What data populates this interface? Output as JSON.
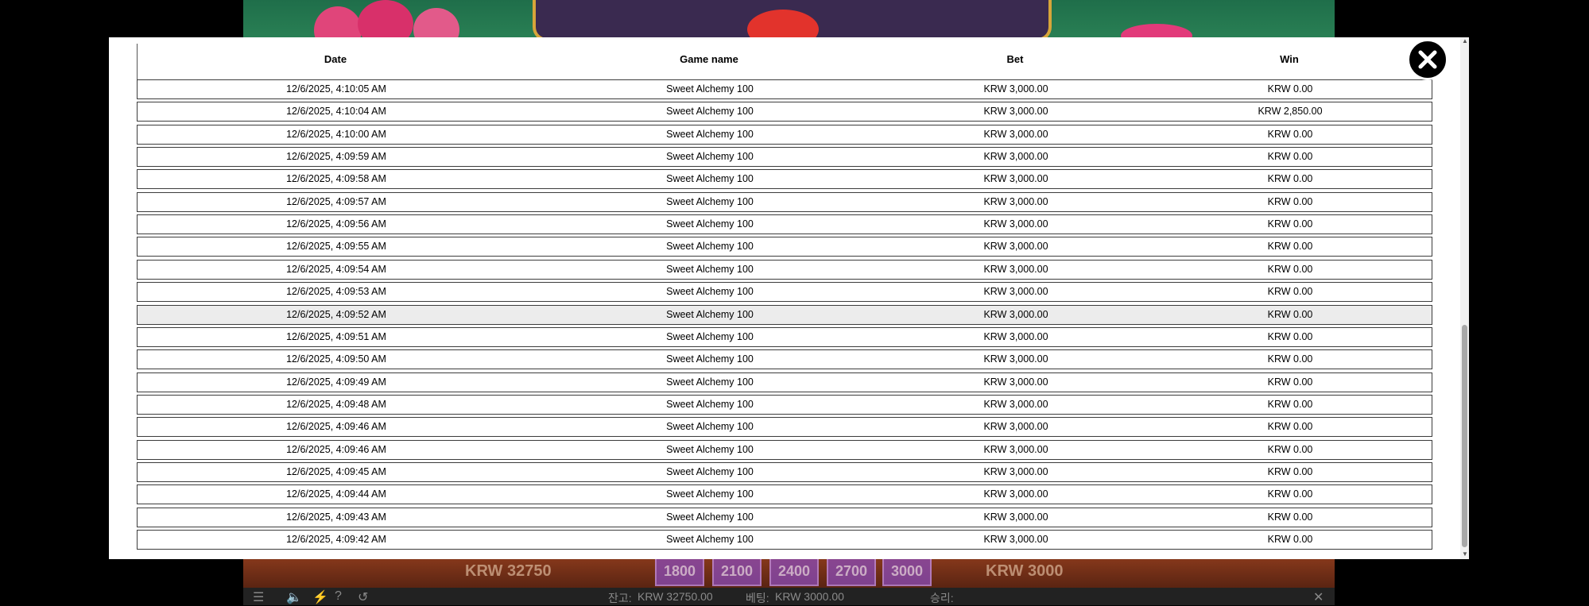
{
  "game_hud": {
    "balance_amount": "KRW 32750",
    "bet_amount": "KRW 3000",
    "bet_chips": [
      "1800",
      "2100",
      "2400",
      "2700",
      "3000"
    ],
    "balance_label": "잔고:",
    "balance_value": "KRW 32750.00",
    "bet_label": "베팅:",
    "bet_value": "KRW 3000.00",
    "win_label": "승리:"
  },
  "history": {
    "headers": {
      "date": "Date",
      "game_name": "Game name",
      "bet": "Bet",
      "win": "Win"
    },
    "rows": [
      {
        "date": "12/6/2025, 4:10:05 AM",
        "game": "Sweet Alchemy 100",
        "bet": "KRW 3,000.00",
        "win": "KRW 0.00"
      },
      {
        "date": "12/6/2025, 4:10:04 AM",
        "game": "Sweet Alchemy 100",
        "bet": "KRW 3,000.00",
        "win": "KRW 2,850.00"
      },
      {
        "date": "12/6/2025, 4:10:00 AM",
        "game": "Sweet Alchemy 100",
        "bet": "KRW 3,000.00",
        "win": "KRW 0.00"
      },
      {
        "date": "12/6/2025, 4:09:59 AM",
        "game": "Sweet Alchemy 100",
        "bet": "KRW 3,000.00",
        "win": "KRW 0.00"
      },
      {
        "date": "12/6/2025, 4:09:58 AM",
        "game": "Sweet Alchemy 100",
        "bet": "KRW 3,000.00",
        "win": "KRW 0.00"
      },
      {
        "date": "12/6/2025, 4:09:57 AM",
        "game": "Sweet Alchemy 100",
        "bet": "KRW 3,000.00",
        "win": "KRW 0.00"
      },
      {
        "date": "12/6/2025, 4:09:56 AM",
        "game": "Sweet Alchemy 100",
        "bet": "KRW 3,000.00",
        "win": "KRW 0.00"
      },
      {
        "date": "12/6/2025, 4:09:55 AM",
        "game": "Sweet Alchemy 100",
        "bet": "KRW 3,000.00",
        "win": "KRW 0.00"
      },
      {
        "date": "12/6/2025, 4:09:54 AM",
        "game": "Sweet Alchemy 100",
        "bet": "KRW 3,000.00",
        "win": "KRW 0.00"
      },
      {
        "date": "12/6/2025, 4:09:53 AM",
        "game": "Sweet Alchemy 100",
        "bet": "KRW 3,000.00",
        "win": "KRW 0.00"
      },
      {
        "date": "12/6/2025, 4:09:52 AM",
        "game": "Sweet Alchemy 100",
        "bet": "KRW 3,000.00",
        "win": "KRW 0.00",
        "highlighted": true
      },
      {
        "date": "12/6/2025, 4:09:51 AM",
        "game": "Sweet Alchemy 100",
        "bet": "KRW 3,000.00",
        "win": "KRW 0.00"
      },
      {
        "date": "12/6/2025, 4:09:50 AM",
        "game": "Sweet Alchemy 100",
        "bet": "KRW 3,000.00",
        "win": "KRW 0.00"
      },
      {
        "date": "12/6/2025, 4:09:49 AM",
        "game": "Sweet Alchemy 100",
        "bet": "KRW 3,000.00",
        "win": "KRW 0.00"
      },
      {
        "date": "12/6/2025, 4:09:48 AM",
        "game": "Sweet Alchemy 100",
        "bet": "KRW 3,000.00",
        "win": "KRW 0.00"
      },
      {
        "date": "12/6/2025, 4:09:46 AM",
        "game": "Sweet Alchemy 100",
        "bet": "KRW 3,000.00",
        "win": "KRW 0.00"
      },
      {
        "date": "12/6/2025, 4:09:46 AM",
        "game": "Sweet Alchemy 100",
        "bet": "KRW 3,000.00",
        "win": "KRW 0.00"
      },
      {
        "date": "12/6/2025, 4:09:45 AM",
        "game": "Sweet Alchemy 100",
        "bet": "KRW 3,000.00",
        "win": "KRW 0.00"
      },
      {
        "date": "12/6/2025, 4:09:44 AM",
        "game": "Sweet Alchemy 100",
        "bet": "KRW 3,000.00",
        "win": "KRW 0.00"
      },
      {
        "date": "12/6/2025, 4:09:43 AM",
        "game": "Sweet Alchemy 100",
        "bet": "KRW 3,000.00",
        "win": "KRW 0.00"
      },
      {
        "date": "12/6/2025, 4:09:42 AM",
        "game": "Sweet Alchemy 100",
        "bet": "KRW 3,000.00",
        "win": "KRW 0.00"
      }
    ]
  },
  "icons": {
    "close": "close-icon",
    "menu": "hamburger-menu-icon",
    "sound": "speaker-icon",
    "turbo": "lightning-icon",
    "help": "question-icon",
    "history": "history-icon"
  },
  "colors": {
    "modal_bg": "#ffffff",
    "row_highlight": "#ececec",
    "row_border": "#3c3c3c",
    "close_bg": "#000000"
  }
}
